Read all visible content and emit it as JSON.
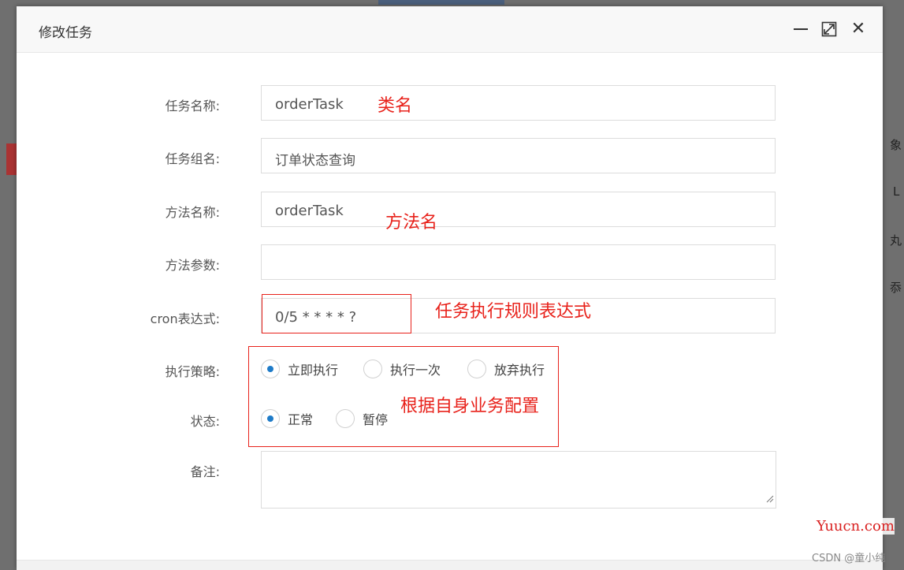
{
  "dialog": {
    "title": "修改任务",
    "controls": {
      "minimize": "minimize-icon",
      "maximize": "maximize-icon",
      "close": "close-icon"
    }
  },
  "form": {
    "task_name": {
      "label": "任务名称:",
      "value": "orderTask"
    },
    "task_group": {
      "label": "任务组名:",
      "value": "订单状态查询"
    },
    "method_name": {
      "label": "方法名称:",
      "value": "orderTask"
    },
    "method_params": {
      "label": "方法参数:",
      "value": ""
    },
    "cron": {
      "label": "cron表达式:",
      "value": "0/5 * * * * ?"
    },
    "strategy": {
      "label": "执行策略:",
      "options": [
        "立即执行",
        "执行一次",
        "放弃执行"
      ],
      "selected": "立即执行"
    },
    "status": {
      "label": "状态:",
      "options": [
        "正常",
        "暂停"
      ],
      "selected": "正常"
    },
    "remark": {
      "label": "备注:",
      "value": ""
    }
  },
  "annotations": {
    "class_name": "类名",
    "method_name": "方法名",
    "cron_rule": "任务执行规则表达式",
    "config_note": "根据自身业务配置",
    "color": "#e8221b"
  },
  "background": {
    "chars": [
      "象",
      "L",
      "丸",
      "忝"
    ]
  },
  "watermarks": {
    "site": "Yuucn.com",
    "csdn": "CSDN @童小纯"
  },
  "colors": {
    "radio_selected": "#1e7bc8",
    "overlay": "#6f6f6f"
  }
}
